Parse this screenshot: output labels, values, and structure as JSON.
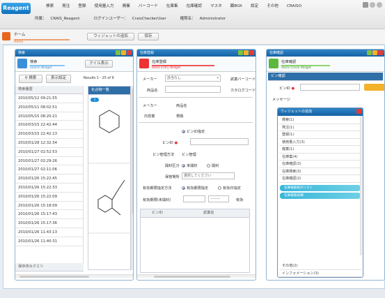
{
  "app": {
    "logo": "Reagent"
  },
  "menu": [
    "検索",
    "発注",
    "登録",
    "使用量入力",
    "廃棄",
    "バーコード",
    "在庫集",
    "在庫確認",
    "マスタ",
    "顕BOX",
    "設定",
    "その他",
    "CRAISO"
  ],
  "info": {
    "section_label": "所属：",
    "section_value": "CRAIS_Reagent",
    "login_label": "ログインユーザー：",
    "login_value": "CraisCheckerUser",
    "auth_label": "権限名：",
    "auth_value": "Administrator"
  },
  "home": {
    "label": "ホーム",
    "sub": "Home",
    "widget_button": "ウィジェットの追加",
    "save_button": "保存"
  },
  "panel_search": {
    "title": "検索",
    "sub_title": "検索",
    "sub_caption": "Search Widget",
    "query_button": "クイル表示",
    "search_button": "検索",
    "condition_button": "表示設定",
    "results_text": "Results 1 - 25 of 9",
    "list_header": "検索履歴",
    "history": [
      "2010/05/12 09:21:55",
      "2010/05/11 08:02:51",
      "2010/05/15 08:20:21",
      "2010/03/15 22:42:44",
      "2010/03/15 22:42:13",
      "2010/01/28 12:32:34",
      "2010/01/27 02:52:53",
      "2010/01/27 02:29:26",
      "2010/01/27 02:11:06",
      "2010/01/26 15:22:45",
      "2010/01/26 15:22:33",
      "2010/01/26 15:22:09",
      "2010/01/26 15:18:09",
      "2010/01/26 15:17:43",
      "2010/01/26 15:17:36",
      "2010/01/26 11:43:13",
      "2010/01/26 11:40:31"
    ],
    "footer": "保存済みクエリ",
    "structure_header": "化合物一覧",
    "badge": "1"
  },
  "panel_stock": {
    "title": "在庫登録",
    "sub_title": "在庫登録",
    "sub_caption": "Stock Entry Widget",
    "maker_label": "メーカー",
    "maker_value": "該当なし",
    "barcode_label": "試薬バーコード",
    "name_label": "商品名",
    "catalog_label": "カタログコード",
    "maker2_label": "メーカー",
    "maker2_value": "商品名",
    "content_label": "内容量",
    "content_value": "規格",
    "radio_bottle": "ビンID指定",
    "bottle_id_label": "ビンID",
    "manage_label": "ビン管理方法",
    "manage_value": "ビン管理",
    "open_label": "開封区分",
    "open_unopened": "未開封",
    "open_opened": "開封",
    "place_label": "保管場所",
    "place_value": "選択してください",
    "expiry_method_label": "有効期限指定方法",
    "expiry_opt1": "有効期限指定",
    "expiry_opt2": "有効日指定",
    "expiry_label": "有効期限(未開封)",
    "expiry_select": "--------",
    "expiry_tail": "有効",
    "col_id": "ビンID",
    "col_name": "試薬名"
  },
  "panel_stock_check": {
    "title": "在庫確認",
    "sub_title": "在庫確認",
    "sub_caption": "Stock Check Widget",
    "bar_label": "ビン確認",
    "bottle_label": "ビンID",
    "message_label": "メッセージ"
  },
  "popup": {
    "title": "ウィジェットの追加",
    "items": [
      "検索(1)",
      "発注(1)",
      "登録(1)",
      "使用量入力(3)",
      "廃棄(1)",
      "在庫集(4)",
      "在庫確認(3)",
      "在庫検索(3)",
      "在庫確認(2)"
    ],
    "pill1": "在庫検索統計リスト",
    "pill2": "在庫検索詳細",
    "footer1": "その他(2)",
    "footer2": "インフォメーション(3)"
  }
}
